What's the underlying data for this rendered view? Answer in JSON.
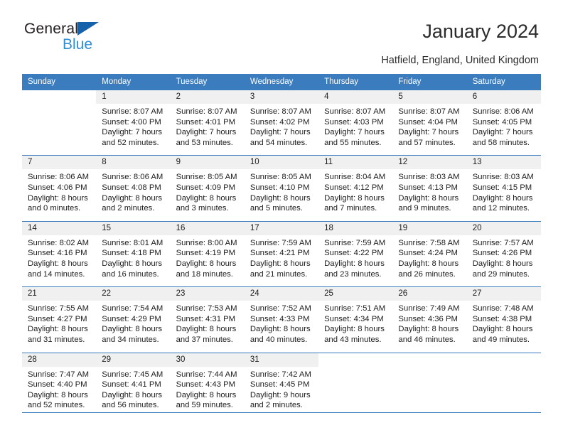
{
  "brand": {
    "name_part1": "General",
    "name_part2": "Blue",
    "triangle_icon": "blue-triangle-icon"
  },
  "header": {
    "title": "January 2024",
    "subtitle": "Hatfield, England, United Kingdom"
  },
  "colors": {
    "header_blue": "#3a7cbe",
    "daynum_background": "#f0f0f0",
    "brand_blue": "#2e8fd6",
    "triangle_blue": "#1461ac",
    "text": "#1c1c1c"
  },
  "weekday_headers": [
    "Sunday",
    "Monday",
    "Tuesday",
    "Wednesday",
    "Thursday",
    "Friday",
    "Saturday"
  ],
  "weeks": [
    {
      "days": [
        {
          "num": "",
          "lines": []
        },
        {
          "num": "1",
          "lines": [
            "Sunrise: 8:07 AM",
            "Sunset: 4:00 PM",
            "Daylight: 7 hours",
            "and 52 minutes."
          ]
        },
        {
          "num": "2",
          "lines": [
            "Sunrise: 8:07 AM",
            "Sunset: 4:01 PM",
            "Daylight: 7 hours",
            "and 53 minutes."
          ]
        },
        {
          "num": "3",
          "lines": [
            "Sunrise: 8:07 AM",
            "Sunset: 4:02 PM",
            "Daylight: 7 hours",
            "and 54 minutes."
          ]
        },
        {
          "num": "4",
          "lines": [
            "Sunrise: 8:07 AM",
            "Sunset: 4:03 PM",
            "Daylight: 7 hours",
            "and 55 minutes."
          ]
        },
        {
          "num": "5",
          "lines": [
            "Sunrise: 8:07 AM",
            "Sunset: 4:04 PM",
            "Daylight: 7 hours",
            "and 57 minutes."
          ]
        },
        {
          "num": "6",
          "lines": [
            "Sunrise: 8:06 AM",
            "Sunset: 4:05 PM",
            "Daylight: 7 hours",
            "and 58 minutes."
          ]
        }
      ]
    },
    {
      "days": [
        {
          "num": "7",
          "lines": [
            "Sunrise: 8:06 AM",
            "Sunset: 4:06 PM",
            "Daylight: 8 hours",
            "and 0 minutes."
          ]
        },
        {
          "num": "8",
          "lines": [
            "Sunrise: 8:06 AM",
            "Sunset: 4:08 PM",
            "Daylight: 8 hours",
            "and 2 minutes."
          ]
        },
        {
          "num": "9",
          "lines": [
            "Sunrise: 8:05 AM",
            "Sunset: 4:09 PM",
            "Daylight: 8 hours",
            "and 3 minutes."
          ]
        },
        {
          "num": "10",
          "lines": [
            "Sunrise: 8:05 AM",
            "Sunset: 4:10 PM",
            "Daylight: 8 hours",
            "and 5 minutes."
          ]
        },
        {
          "num": "11",
          "lines": [
            "Sunrise: 8:04 AM",
            "Sunset: 4:12 PM",
            "Daylight: 8 hours",
            "and 7 minutes."
          ]
        },
        {
          "num": "12",
          "lines": [
            "Sunrise: 8:03 AM",
            "Sunset: 4:13 PM",
            "Daylight: 8 hours",
            "and 9 minutes."
          ]
        },
        {
          "num": "13",
          "lines": [
            "Sunrise: 8:03 AM",
            "Sunset: 4:15 PM",
            "Daylight: 8 hours",
            "and 12 minutes."
          ]
        }
      ]
    },
    {
      "days": [
        {
          "num": "14",
          "lines": [
            "Sunrise: 8:02 AM",
            "Sunset: 4:16 PM",
            "Daylight: 8 hours",
            "and 14 minutes."
          ]
        },
        {
          "num": "15",
          "lines": [
            "Sunrise: 8:01 AM",
            "Sunset: 4:18 PM",
            "Daylight: 8 hours",
            "and 16 minutes."
          ]
        },
        {
          "num": "16",
          "lines": [
            "Sunrise: 8:00 AM",
            "Sunset: 4:19 PM",
            "Daylight: 8 hours",
            "and 18 minutes."
          ]
        },
        {
          "num": "17",
          "lines": [
            "Sunrise: 7:59 AM",
            "Sunset: 4:21 PM",
            "Daylight: 8 hours",
            "and 21 minutes."
          ]
        },
        {
          "num": "18",
          "lines": [
            "Sunrise: 7:59 AM",
            "Sunset: 4:22 PM",
            "Daylight: 8 hours",
            "and 23 minutes."
          ]
        },
        {
          "num": "19",
          "lines": [
            "Sunrise: 7:58 AM",
            "Sunset: 4:24 PM",
            "Daylight: 8 hours",
            "and 26 minutes."
          ]
        },
        {
          "num": "20",
          "lines": [
            "Sunrise: 7:57 AM",
            "Sunset: 4:26 PM",
            "Daylight: 8 hours",
            "and 29 minutes."
          ]
        }
      ]
    },
    {
      "days": [
        {
          "num": "21",
          "lines": [
            "Sunrise: 7:55 AM",
            "Sunset: 4:27 PM",
            "Daylight: 8 hours",
            "and 31 minutes."
          ]
        },
        {
          "num": "22",
          "lines": [
            "Sunrise: 7:54 AM",
            "Sunset: 4:29 PM",
            "Daylight: 8 hours",
            "and 34 minutes."
          ]
        },
        {
          "num": "23",
          "lines": [
            "Sunrise: 7:53 AM",
            "Sunset: 4:31 PM",
            "Daylight: 8 hours",
            "and 37 minutes."
          ]
        },
        {
          "num": "24",
          "lines": [
            "Sunrise: 7:52 AM",
            "Sunset: 4:33 PM",
            "Daylight: 8 hours",
            "and 40 minutes."
          ]
        },
        {
          "num": "25",
          "lines": [
            "Sunrise: 7:51 AM",
            "Sunset: 4:34 PM",
            "Daylight: 8 hours",
            "and 43 minutes."
          ]
        },
        {
          "num": "26",
          "lines": [
            "Sunrise: 7:49 AM",
            "Sunset: 4:36 PM",
            "Daylight: 8 hours",
            "and 46 minutes."
          ]
        },
        {
          "num": "27",
          "lines": [
            "Sunrise: 7:48 AM",
            "Sunset: 4:38 PM",
            "Daylight: 8 hours",
            "and 49 minutes."
          ]
        }
      ]
    },
    {
      "days": [
        {
          "num": "28",
          "lines": [
            "Sunrise: 7:47 AM",
            "Sunset: 4:40 PM",
            "Daylight: 8 hours",
            "and 52 minutes."
          ]
        },
        {
          "num": "29",
          "lines": [
            "Sunrise: 7:45 AM",
            "Sunset: 4:41 PM",
            "Daylight: 8 hours",
            "and 56 minutes."
          ]
        },
        {
          "num": "30",
          "lines": [
            "Sunrise: 7:44 AM",
            "Sunset: 4:43 PM",
            "Daylight: 8 hours",
            "and 59 minutes."
          ]
        },
        {
          "num": "31",
          "lines": [
            "Sunrise: 7:42 AM",
            "Sunset: 4:45 PM",
            "Daylight: 9 hours",
            "and 2 minutes."
          ]
        },
        {
          "num": "",
          "lines": []
        },
        {
          "num": "",
          "lines": []
        },
        {
          "num": "",
          "lines": []
        }
      ]
    }
  ]
}
